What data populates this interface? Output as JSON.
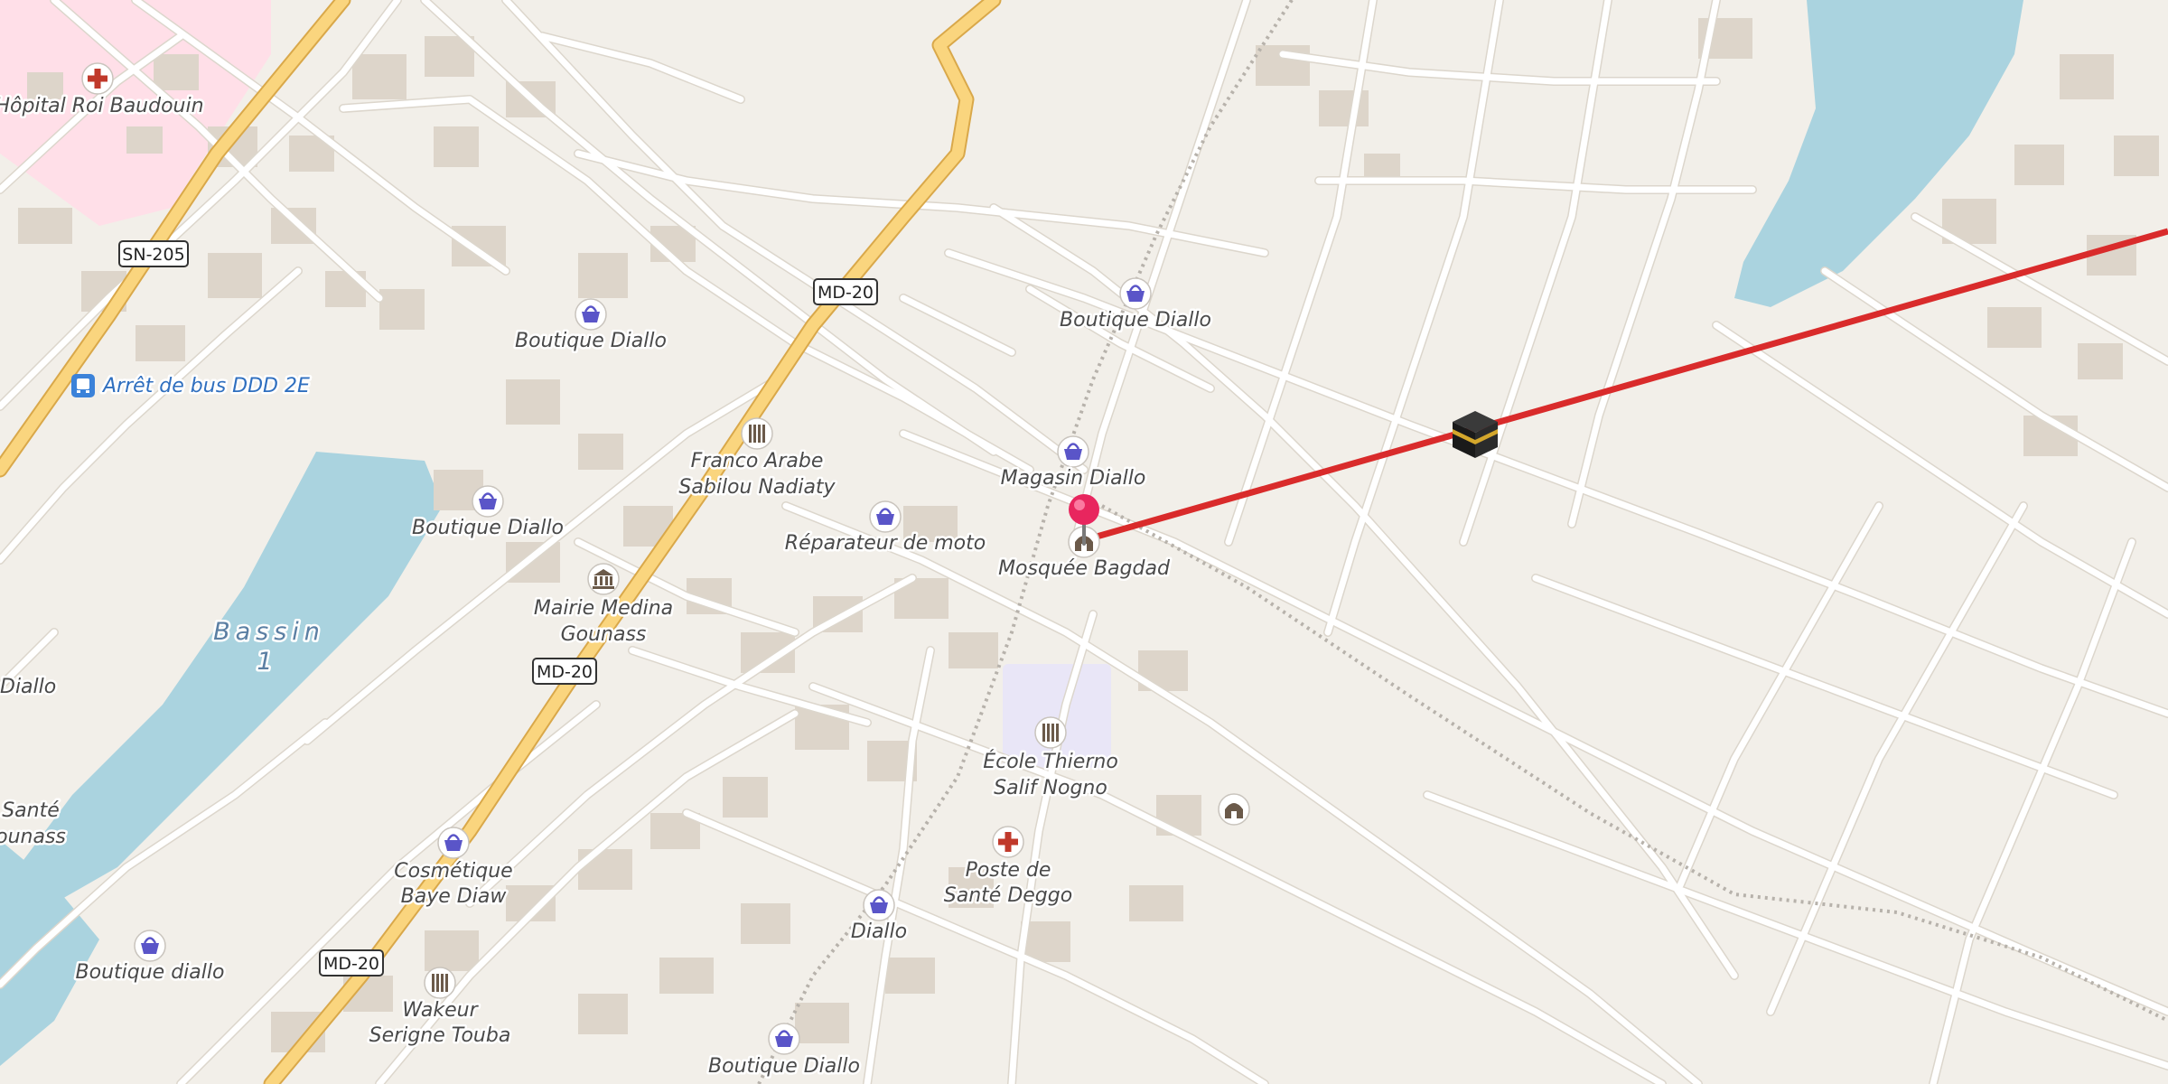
{
  "map": {
    "road_shields": [
      {
        "id": "sn205",
        "text": "SN-205"
      },
      {
        "id": "md20a",
        "text": "MD-20"
      },
      {
        "id": "md20b",
        "text": "MD-20"
      },
      {
        "id": "md20c",
        "text": "MD-20"
      }
    ],
    "water_label": [
      "Bassin",
      "1"
    ],
    "pois": [
      {
        "id": "hopital",
        "icon": "hospital-cross-icon",
        "lines": [
          "Hôpital Roi Baudouin"
        ]
      },
      {
        "id": "arret",
        "icon": "bus-stop-icon",
        "lines": [
          "Arrêt de bus DDD 2E"
        ]
      },
      {
        "id": "boutique1",
        "icon": "shop-basket-icon",
        "lines": [
          "Boutique Diallo"
        ]
      },
      {
        "id": "boutique2",
        "icon": "shop-basket-icon",
        "lines": [
          "Boutique Diallo"
        ]
      },
      {
        "id": "boutique3",
        "icon": "shop-basket-icon",
        "lines": [
          "Boutique Diallo"
        ]
      },
      {
        "id": "franco",
        "icon": "school-icon",
        "lines": [
          "Franco Arabe",
          "Sabilou Nadiaty"
        ]
      },
      {
        "id": "magasin",
        "icon": "shop-basket-icon",
        "lines": [
          "Magasin Diallo"
        ]
      },
      {
        "id": "reparateur",
        "icon": "shop-basket-icon",
        "lines": [
          "Réparateur de moto"
        ]
      },
      {
        "id": "mosquee",
        "icon": "mosque-icon",
        "lines": [
          "Mosquée Bagdad"
        ]
      },
      {
        "id": "mairie",
        "icon": "town-hall-icon",
        "lines": [
          "Mairie Medina",
          "Gounass"
        ]
      },
      {
        "id": "diallo-left",
        "icon": "",
        "lines": [
          "Diallo"
        ]
      },
      {
        "id": "sante-left",
        "icon": "",
        "lines": [
          "Santé",
          "ounass"
        ]
      },
      {
        "id": "ecole",
        "icon": "school-icon",
        "lines": [
          "École Thierno",
          "Salif Nogno"
        ]
      },
      {
        "id": "cosmetique",
        "icon": "shop-basket-icon",
        "lines": [
          "Cosmétique",
          "Baye Diaw"
        ]
      },
      {
        "id": "poste",
        "icon": "hospital-cross-icon",
        "lines": [
          "Poste de",
          "Santé Deggo"
        ]
      },
      {
        "id": "diallo-bottom",
        "icon": "shop-basket-icon",
        "lines": [
          "Diallo"
        ]
      },
      {
        "id": "boutique-diallo-lower",
        "icon": "shop-basket-icon",
        "lines": [
          "Boutique diallo"
        ]
      },
      {
        "id": "wakeur",
        "icon": "school-icon",
        "lines": [
          "Wakeur",
          "Serigne Touba"
        ]
      },
      {
        "id": "boutique-bottom",
        "icon": "shop-basket-icon",
        "lines": [
          "Boutique Diallo"
        ]
      },
      {
        "id": "mosque-unnamed",
        "icon": "mosque-icon",
        "lines": []
      }
    ],
    "markers": {
      "location_pin": "location-pin-icon",
      "kaaba": "kaaba-icon"
    },
    "colors": {
      "land": "#f2efe9",
      "road": "#ffffff",
      "major_road": "#fad57e",
      "water": "#aad3df",
      "hospital_area": "#ffdfe8",
      "school_area": "#e9e6f7",
      "qibla_line": "#d92b2b",
      "pin": "#e8265e",
      "shop_icon": "#5a55c8"
    }
  }
}
